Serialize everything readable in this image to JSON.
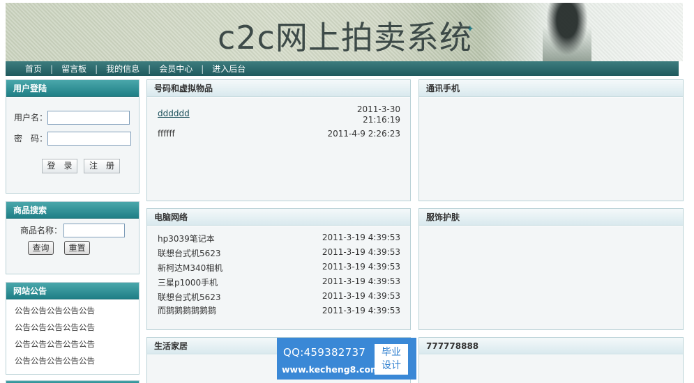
{
  "banner": {
    "title": "c2c网上拍卖系统"
  },
  "nav": {
    "items": [
      "首页",
      "留言板",
      "我的信息",
      "会员中心",
      "进入后台"
    ],
    "separator": "|"
  },
  "login": {
    "title": "用户登陆",
    "username_label": "用户名：",
    "password_label": "密　码：",
    "login_button": "登　录",
    "register_button": "注　册"
  },
  "search": {
    "title": "商品搜索",
    "name_label": "商品名称：",
    "query_button": "查询",
    "reset_button": "重置"
  },
  "notices": {
    "title": "网站公告",
    "items": [
      "公告公告公告公告公告",
      "公告公告公告公告公告",
      "公告公告公告公告公告",
      "公告公告公告公告公告"
    ]
  },
  "categories": [
    {
      "title": "号码和虚拟物品",
      "items": [
        {
          "name": "dddddd",
          "date": "2011-3-30",
          "time": "21:16:19"
        },
        {
          "name": "ffffff",
          "date": "2011-4-9 2:26:23"
        }
      ]
    },
    {
      "title": "通讯手机",
      "items": []
    },
    {
      "title": "电脑网络",
      "items": [
        {
          "name": "hp3039笔记本",
          "date": "2011-3-19 4:39:53"
        },
        {
          "name": "联想台式机5623",
          "date": "2011-3-19 4:39:53"
        },
        {
          "name": "新柯达M340相机",
          "date": "2011-3-19 4:39:53"
        },
        {
          "name": "三星p1000手机",
          "date": "2011-3-19 4:39:53"
        },
        {
          "name": "联想台式机5623",
          "date": "2011-3-19 4:39:53"
        },
        {
          "name": "而鹅鹅鹅鹅鹅鹅",
          "date": "2011-3-19 4:39:53"
        }
      ]
    },
    {
      "title": "服饰护肤",
      "items": []
    },
    {
      "title": "生活家居",
      "items": []
    },
    {
      "title": "777778888",
      "items": []
    }
  ],
  "watermark": {
    "qq": "QQ:459382737",
    "site": "www.kecheng8.com",
    "badge_line1": "毕业",
    "badge_line2": "设计"
  },
  "colors": {
    "nav_bg": "#1f5a5e",
    "left_header_bg": "#1f7f86",
    "panel_border": "#b9d1d6",
    "watermark_bg": "#3a88d6"
  }
}
